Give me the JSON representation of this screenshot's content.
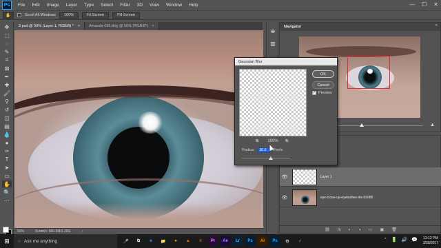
{
  "app": {
    "logo": "Ps"
  },
  "menu": [
    "File",
    "Edit",
    "Image",
    "Layer",
    "Type",
    "Select",
    "Filter",
    "3D",
    "View",
    "Window",
    "Help"
  ],
  "window_controls": {
    "minimize": "—",
    "maximize": "☐",
    "close": "✕"
  },
  "options_bar": {
    "scroll_all_label": "Scroll All Windows",
    "zoom_value": "100%",
    "fit_screen": "Fit Screen",
    "fill_screen": "Fill Screen"
  },
  "tabs": [
    {
      "label": "3.psd @ 50% (Layer 1, RGB/8) *",
      "close": "×"
    },
    {
      "label": "Amanda-095.dng @ 50% (RGB/8*)",
      "close": "×"
    }
  ],
  "status": {
    "zoom": "50%",
    "doc": "Scratch: 980.9M/3.29G",
    "arrow": "›"
  },
  "navigator": {
    "title": "Navigator",
    "collapse": "«",
    "zoom_out": "▲",
    "zoom_in": "▲"
  },
  "layers": {
    "rows": [
      {
        "name": "Layer 1",
        "eye": "👁"
      },
      {
        "name": "eye-close-up-eyelashes-iris-59086",
        "eye": "👁"
      }
    ],
    "footer_icons": [
      "⛓",
      "fx",
      "◐",
      "◑",
      "▭",
      "▣",
      "🗑"
    ]
  },
  "dialog": {
    "title": "Gaussian Blur",
    "zoom_out": "🔍",
    "zoom_level": "100%",
    "zoom_in": "🔍",
    "radius_label": "Radius:",
    "radius_value": "30.0",
    "radius_unit": "Pixels",
    "ok": "OK",
    "cancel": "Cancel",
    "preview_label": "Preview",
    "preview_check": "✓"
  },
  "taskbar": {
    "start_icon": "⊞",
    "search_icon": "○",
    "search_placeholder": "Ask me anything",
    "apps": [
      {
        "label": "🎤",
        "bg": "#1b1b1b",
        "fg": "#dddddd"
      },
      {
        "label": "⧉",
        "bg": "#1b1b1b",
        "fg": "#dddddd"
      },
      {
        "label": "e",
        "bg": "#1b1b1b",
        "fg": "#3aa0ff"
      },
      {
        "label": "📁",
        "bg": "#1b1b1b",
        "fg": "#f5c542"
      },
      {
        "label": "●",
        "bg": "#1b1b1b",
        "fg": "#f4b400"
      },
      {
        "label": "▲",
        "bg": "#1b1b1b",
        "fg": "#ff7a00"
      },
      {
        "label": "≡",
        "bg": "#1b1b1b",
        "fg": "#ff9c2a"
      },
      {
        "label": "Pr",
        "bg": "#2a0a3d",
        "fg": "#e08bff"
      },
      {
        "label": "Ae",
        "bg": "#1a0a3d",
        "fg": "#a78bff"
      },
      {
        "label": "Lr",
        "bg": "#0a2236",
        "fg": "#49b8f0"
      },
      {
        "label": "Ps",
        "bg": "#001e36",
        "fg": "#31a8ff"
      },
      {
        "label": "Ai",
        "bg": "#331c00",
        "fg": "#ff9a00"
      },
      {
        "label": "Ps",
        "bg": "#001e36",
        "fg": "#31a8ff"
      },
      {
        "label": "⚙",
        "bg": "#1b1b1b",
        "fg": "#cccccc"
      },
      {
        "label": "♪",
        "bg": "#1b1b1b",
        "fg": "#cccccc"
      }
    ],
    "tray": [
      "⌃",
      "🔋",
      "🔊",
      "💬"
    ],
    "time": "12:12 PM",
    "date": "3/30/2017"
  },
  "colors": {
    "accent": "#31a8ff",
    "selection_blue": "#2a63c7",
    "nav_box": "#e03030"
  }
}
